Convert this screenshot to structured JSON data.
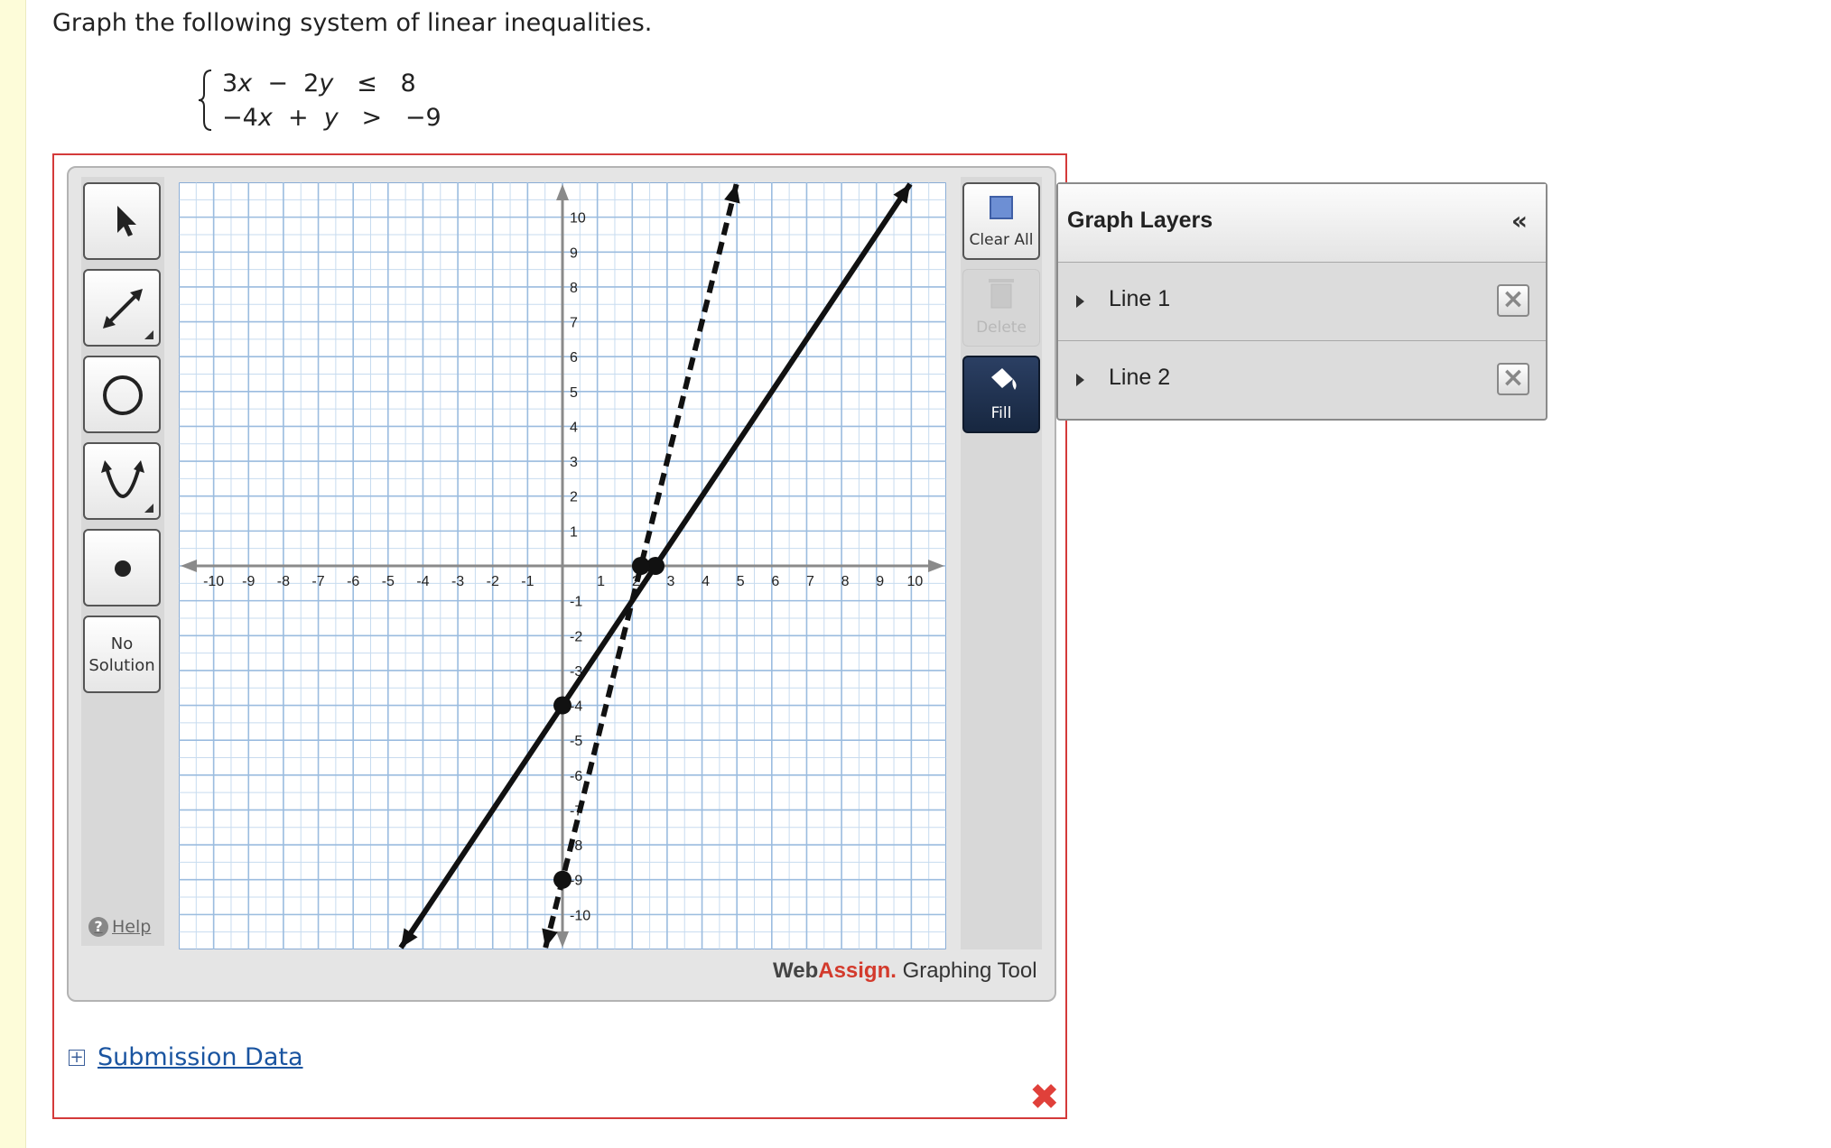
{
  "question": {
    "prompt": "Graph the following system of linear inequalities.",
    "inequality_1": {
      "a": "3",
      "x": "x",
      "op1": "−",
      "b": "2",
      "y": "y",
      "rel": "≤",
      "rhs": "8"
    },
    "inequality_2": {
      "a": "−4",
      "x": "x",
      "op1": "+",
      "y": "y",
      "rel": ">",
      "rhs": "−9"
    }
  },
  "toolbar": {
    "tools": [
      "pointer-icon",
      "line-tool-icon",
      "circle-tool-icon",
      "parabola-tool-icon",
      "point-tool-icon"
    ],
    "no_solution_line1": "No",
    "no_solution_line2": "Solution",
    "help_label": "Help"
  },
  "actions": {
    "clear_all_label": "Clear All",
    "delete_label": "Delete",
    "fill_label": "Fill"
  },
  "brand": {
    "web": "Web",
    "assign": "Assign.",
    "tool": " Graphing Tool"
  },
  "layers_panel": {
    "title": "Graph Layers",
    "collapse": "«",
    "layers": [
      {
        "name": "Line 1"
      },
      {
        "name": "Line 2"
      }
    ]
  },
  "submission": {
    "label": "Submission Data",
    "expand": "+"
  },
  "status": {
    "incorrect_mark": "✖"
  },
  "colors": {
    "answer_border": "#d43a3a",
    "grid_blue": "#9bbcdf",
    "fill_button": "#1f3050",
    "brand_red": "#d33a2c",
    "link_blue": "#1a54a0"
  },
  "graph": {
    "x_range": [
      -11,
      11
    ],
    "y_range": [
      -11,
      11
    ],
    "x_tick_labels": [
      "-10",
      "-9",
      "-8",
      "-7",
      "-6",
      "-5",
      "-4",
      "-3",
      "-2",
      "-1",
      "1",
      "2",
      "3",
      "4",
      "5",
      "6",
      "7",
      "8",
      "9",
      "10"
    ],
    "y_tick_labels": [
      "10",
      "9",
      "8",
      "7",
      "6",
      "5",
      "4",
      "3",
      "2",
      "1",
      "-1",
      "-2",
      "-3",
      "-4",
      "-5",
      "-6",
      "-7",
      "-8",
      "-9",
      "-10"
    ],
    "lines": [
      {
        "slope": 1.5,
        "intercept": -4,
        "style": "solid",
        "points": [
          [
            0,
            -4
          ],
          [
            2.667,
            0
          ]
        ]
      },
      {
        "slope": 4,
        "intercept": -9,
        "style": "dashed",
        "points": [
          [
            0,
            -9
          ],
          [
            2.25,
            0
          ]
        ]
      }
    ]
  }
}
